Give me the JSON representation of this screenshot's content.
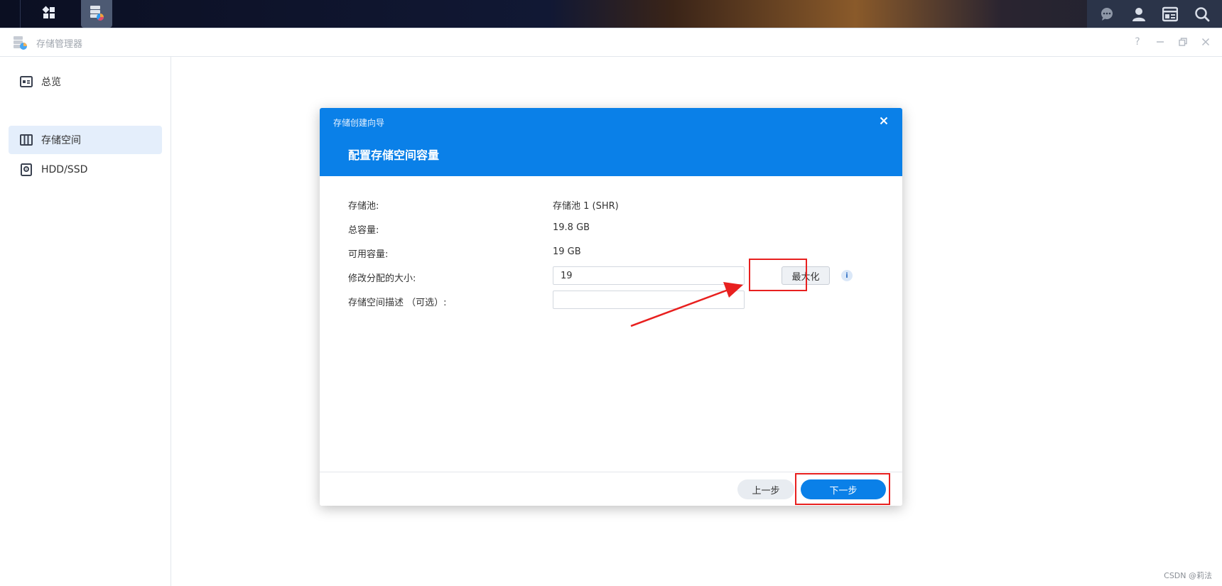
{
  "topbar": {
    "left_icons": [
      "main-menu-icon",
      "storage-manager-app-icon"
    ],
    "right_icons": [
      "chat-icon",
      "user-icon",
      "widgets-icon",
      "search-icon"
    ]
  },
  "window": {
    "title": "存储管理器",
    "controls": [
      "help-icon",
      "minimize-icon",
      "restore-icon",
      "close-icon"
    ]
  },
  "sidebar": {
    "items": [
      {
        "label": "总览",
        "icon": "overview-icon",
        "active": false
      },
      {
        "label": "存储空间",
        "icon": "volume-icon",
        "active": true
      },
      {
        "label": "HDD/SSD",
        "icon": "disk-icon",
        "active": false
      }
    ]
  },
  "dialog": {
    "small_title": "存储创建向导",
    "title": "配置存储空间容量",
    "rows": {
      "pool": {
        "label": "存储池:",
        "value": "存储池 1 (SHR)"
      },
      "total": {
        "label": "总容量:",
        "value": "19.8 GB"
      },
      "available": {
        "label": "可用容量:",
        "value": "19 GB"
      },
      "size": {
        "label": "修改分配的大小:",
        "value": "19",
        "max_label": "最大化"
      },
      "desc": {
        "label": "存储空间描述 （可选）:",
        "value": ""
      }
    },
    "footer": {
      "prev_label": "上一步",
      "next_label": "下一步"
    }
  },
  "colors": {
    "accent": "#0a80e8",
    "annotation": "#e8201f"
  },
  "watermark": "CSDN @莉法"
}
